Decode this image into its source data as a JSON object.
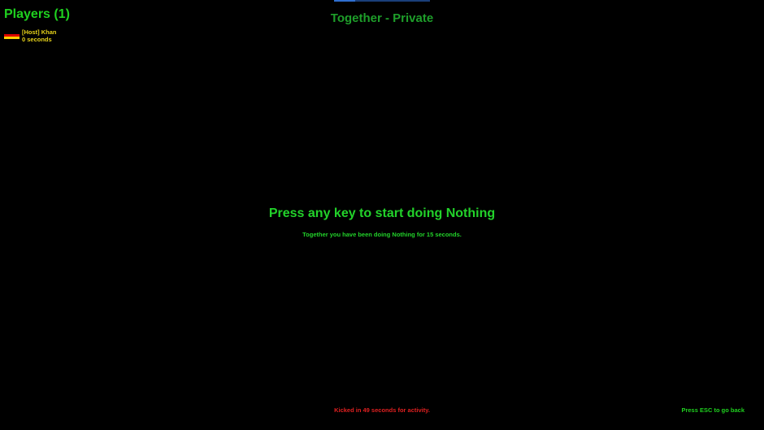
{
  "players": {
    "title": "Players (1)",
    "list": [
      {
        "name": "[Host] Khan",
        "time": "0 seconds",
        "flag_icon": "germany-flag-icon",
        "flag_colors": [
          "#000000",
          "#dd0000",
          "#ffce00"
        ]
      }
    ]
  },
  "lobby": {
    "title": "Together - Private"
  },
  "main": {
    "prompt": "Press any key to start doing Nothing",
    "subtext": "Together you have been doing Nothing for 15 seconds."
  },
  "footer": {
    "kick_warning": "Kicked in 49 seconds for activity.",
    "esc_hint": "Press ESC to go back"
  },
  "colors": {
    "background": "#000000",
    "primary_green": "#1fd11f",
    "title_green": "#1e9e2a",
    "player_yellow": "#e6d21a",
    "warning_red": "#e02020",
    "accent_blue": "#2f6fd0"
  }
}
